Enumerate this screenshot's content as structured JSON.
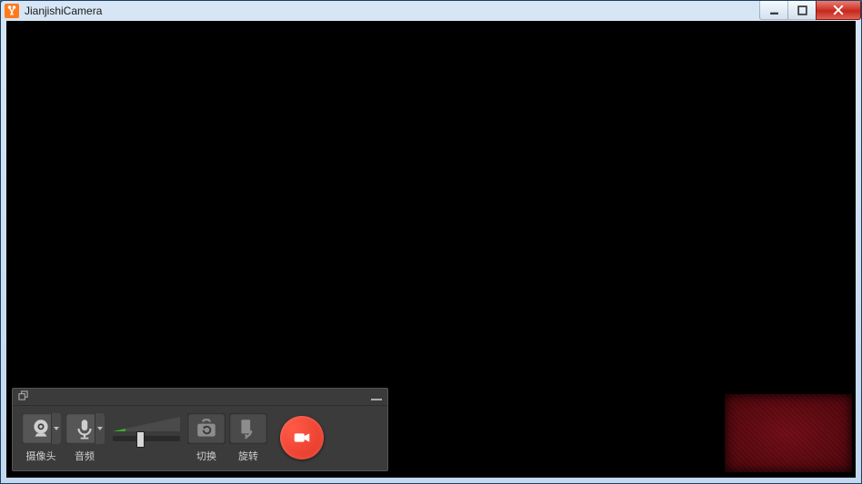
{
  "window": {
    "title": "JianjishiCamera"
  },
  "panel": {
    "camera_label": "摄像头",
    "audio_label": "音频",
    "switch_label": "切换",
    "rotate_label": "旋转",
    "volume_percent": 38
  },
  "icons": {
    "minimize": "minimize-icon",
    "maximize": "maximize-icon",
    "close": "close-icon",
    "undock": "undock-icon",
    "panel_minimize": "panel-minimize-icon",
    "camera": "webcam-icon",
    "mic": "microphone-icon",
    "switch": "switch-camera-icon",
    "rotate": "rotate-icon",
    "record": "video-record-icon"
  },
  "colors": {
    "record_button": "#e23424",
    "panel_bg": "#3b3b3b",
    "accent_green": "#3fae2a"
  }
}
